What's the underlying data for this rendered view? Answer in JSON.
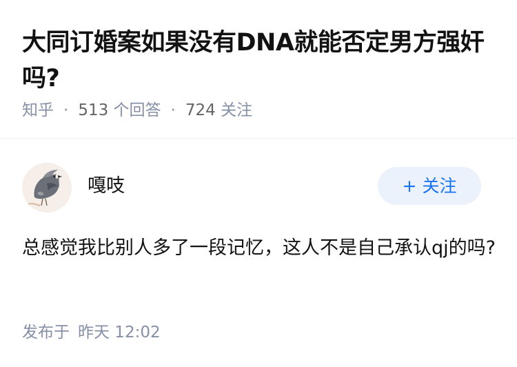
{
  "question": {
    "title": "大同订婚案如果没有DNA就能否定男方强奸吗?",
    "source": "知乎",
    "answer_count": "513",
    "answer_label": "个回答",
    "follow_count": "724",
    "follow_label": "关注"
  },
  "answer": {
    "author_name": "嘎吱",
    "avatar_icon": "raven-avatar",
    "follow_button_plus": "+",
    "follow_button_label": "关注",
    "content": "总感觉我比别人多了一段记忆，这人不是自己承认qj的吗?",
    "published_prefix": "发布于",
    "published_time": "昨天 12:02"
  },
  "colors": {
    "title": "#121212",
    "meta": "#8590a6",
    "accent": "#1772f6",
    "follow_bg": "#ebf2fc"
  }
}
